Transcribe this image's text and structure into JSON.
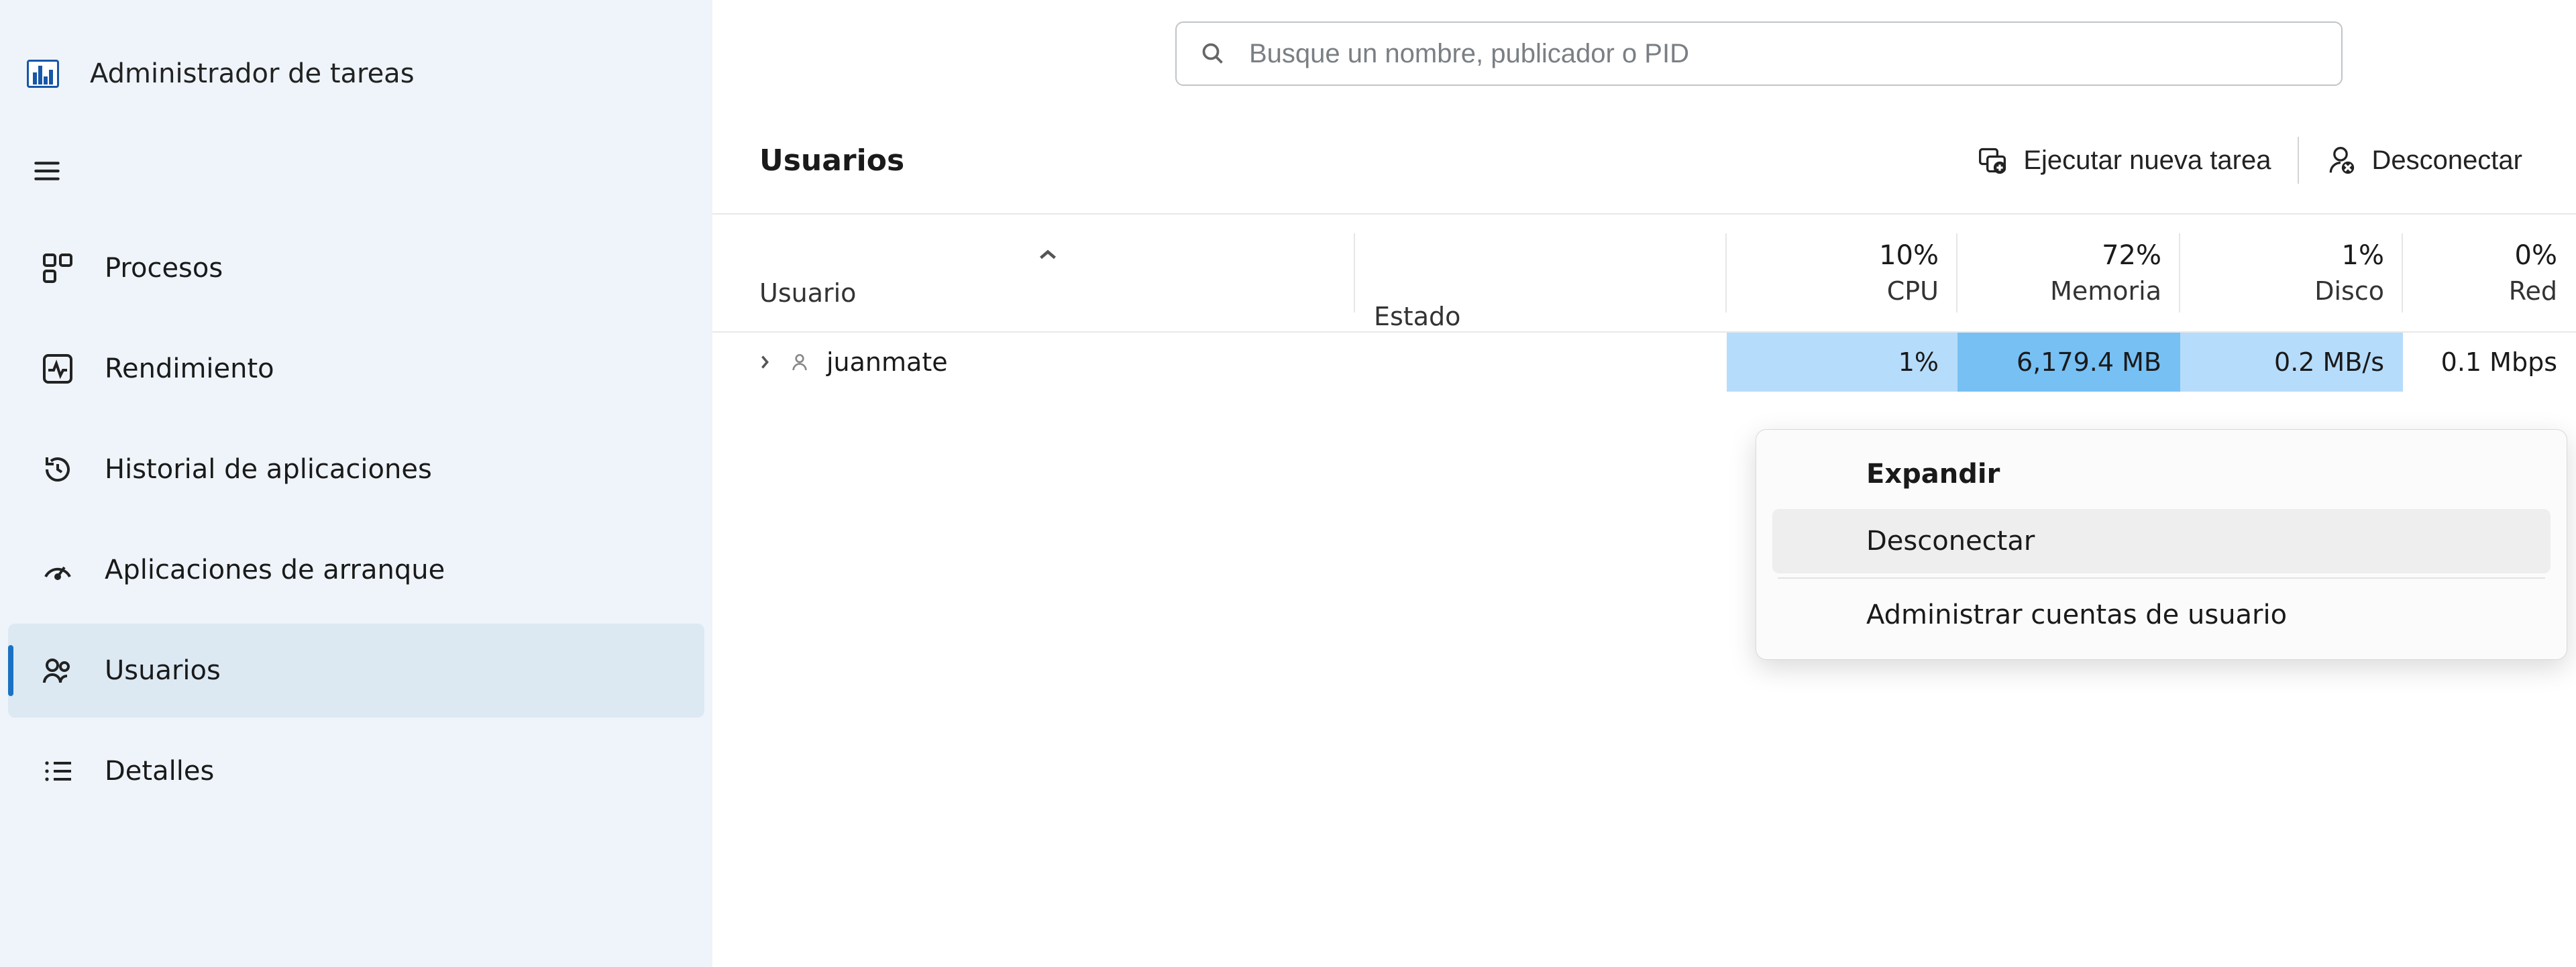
{
  "app": {
    "title": "Administrador de tareas"
  },
  "search": {
    "placeholder": "Busque un nombre, publicador o PID"
  },
  "sidebar": {
    "items": [
      {
        "label": "Procesos"
      },
      {
        "label": "Rendimiento"
      },
      {
        "label": "Historial de aplicaciones"
      },
      {
        "label": "Aplicaciones de arranque"
      },
      {
        "label": "Usuarios"
      },
      {
        "label": "Detalles"
      }
    ]
  },
  "toolbar": {
    "page_title": "Usuarios",
    "run_task": "Ejecutar nueva tarea",
    "disconnect": "Desconectar"
  },
  "columns": {
    "user": "Usuario",
    "state": "Estado",
    "cpu_pct": "10%",
    "cpu": "CPU",
    "mem_pct": "72%",
    "mem": "Memoria",
    "disk_pct": "1%",
    "disk": "Disco",
    "net_pct": "0%",
    "net": "Red"
  },
  "rows": [
    {
      "user": "juanmate",
      "state": "",
      "cpu": "1%",
      "mem": "6,179.4 MB",
      "disk": "0.2 MB/s",
      "net": "0.1 Mbps"
    }
  ],
  "context_menu": {
    "expand": "Expandir",
    "disconnect": "Desconectar",
    "manage": "Administrar cuentas de usuario"
  }
}
